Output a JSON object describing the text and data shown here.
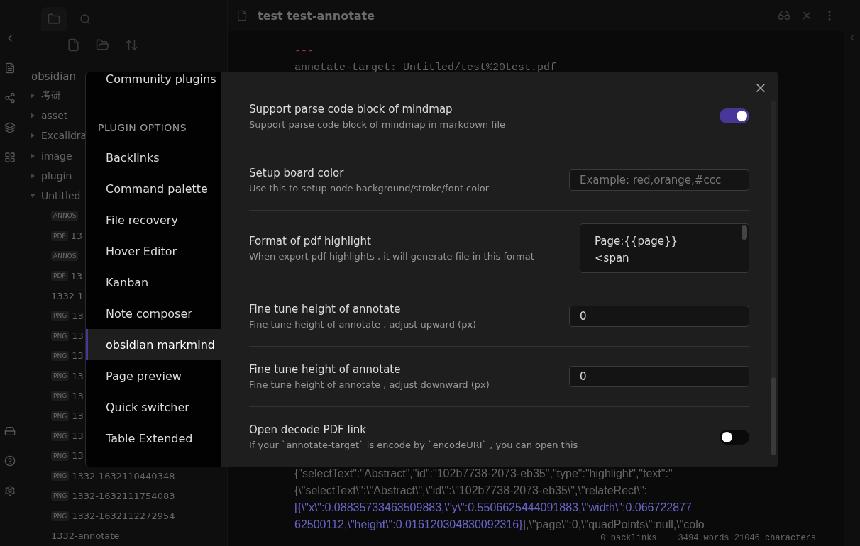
{
  "tab_header": {
    "title": "test test-annotate"
  },
  "explorer": {
    "vault": "obsidian",
    "items": [
      {
        "label": "考研",
        "expanded": false
      },
      {
        "label": "asset",
        "expanded": false
      },
      {
        "label": "Excalidra",
        "expanded": false
      },
      {
        "label": "image",
        "expanded": false
      },
      {
        "label": "plugin",
        "expanded": false
      },
      {
        "label": "Untitled",
        "expanded": true,
        "children": [
          {
            "badge": "ANNOS"
          },
          {
            "badge": "PDF",
            "label": "13"
          },
          {
            "badge": "ANNOS"
          },
          {
            "badge": "PDF",
            "label": "13"
          },
          {
            "label": "1332 1"
          },
          {
            "badge": "PNG",
            "label": "13"
          },
          {
            "badge": "PNG",
            "label": "13"
          },
          {
            "badge": "PNG",
            "label": "13"
          },
          {
            "badge": "PNG",
            "label": "13"
          },
          {
            "badge": "PNG",
            "label": "13"
          },
          {
            "badge": "PNG",
            "label": "13"
          },
          {
            "badge": "PNG",
            "label": "13"
          },
          {
            "badge": "PNG",
            "label": "13"
          },
          {
            "badge": "PNG",
            "label": "1332-1632110440348"
          },
          {
            "badge": "PNG",
            "label": "1332-1632111754083"
          },
          {
            "badge": "PNG",
            "label": "1332-1632112272954"
          },
          {
            "label": "1332-annotate"
          }
        ]
      }
    ]
  },
  "editor": {
    "frontmatter": "---",
    "target_line": "annotate-target: Untitled/test%20test.pdf",
    "json_lines": [
      [
        {
          "kind": "plain",
          "text": "{\"selectText\":\"Abstract\",\"id\":\"102b7738-2073-eb35\",\"type\":\"highlight\",\"text\":\""
        }
      ],
      [
        {
          "kind": "plain",
          "text": "{\\\"selectText\\\":\\\"Abstract\\\",\\\"id\\\":\\\"102b7738-2073-eb35\\\",\\\"relateRect\\\":"
        }
      ],
      [
        {
          "kind": "link",
          "text": "[{\\\"x\\\":0.08835733463509883,\\\"y\\\":0.5506625444091883,\\\"width\\\":0.066722877"
        }
      ],
      [
        {
          "kind": "link",
          "text": "62500112,\\\"height\\\":0.016120304830092316}"
        },
        {
          "kind": "plain",
          "text": "],\\\"page\\\":0,\\\"quadPoints\\\":null,\\\"colo"
        }
      ]
    ]
  },
  "status_bar": {
    "backlinks": "0 backlinks",
    "counts": "3494 words  21046 characters"
  },
  "settings_modal": {
    "nav": [
      {
        "kind": "item",
        "label": "Community plugins",
        "selected": false
      },
      {
        "kind": "heading",
        "label": "PLUGIN OPTIONS"
      },
      {
        "kind": "item",
        "label": "Backlinks",
        "selected": false
      },
      {
        "kind": "item",
        "label": "Command palette",
        "selected": false
      },
      {
        "kind": "item",
        "label": "File recovery",
        "selected": false
      },
      {
        "kind": "item",
        "label": "Hover Editor",
        "selected": false
      },
      {
        "kind": "item",
        "label": "Kanban",
        "selected": false
      },
      {
        "kind": "item",
        "label": "Note composer",
        "selected": false
      },
      {
        "kind": "item",
        "label": "obsidian markmind",
        "selected": true
      },
      {
        "kind": "item",
        "label": "Page preview",
        "selected": false
      },
      {
        "kind": "item",
        "label": "Quick switcher",
        "selected": false
      },
      {
        "kind": "item",
        "label": "Table Extended",
        "selected": false
      }
    ],
    "settings": [
      {
        "kind": "toggle",
        "name": "Support parse code block of mindmap",
        "description": "Support parse code block of mindmap in markdown file",
        "on": true
      },
      {
        "kind": "text",
        "name": "Setup board color",
        "description": "Use this to setup node background/stroke/font color",
        "placeholder": "Example: red,orange,#ccc"
      },
      {
        "kind": "textarea",
        "name": "Format of pdf highlight",
        "description": "When export pdf highlights , it will generate file in this format",
        "lines": [
          "Page:{{page}}",
          "<span"
        ]
      },
      {
        "kind": "text",
        "name": "Fine tune height of annotate",
        "description": "Fine tune height of annotate , adjust upward (px)",
        "value": "0"
      },
      {
        "kind": "text",
        "name": "Fine tune height of annotate",
        "description": "Fine tune height of annotate , adjust downward (px)",
        "value": "0"
      },
      {
        "kind": "toggle",
        "name": "Open decode PDF link",
        "description": "If your `annotate-target` is encode by `encodeURI` , you can open this",
        "on": false
      }
    ]
  }
}
